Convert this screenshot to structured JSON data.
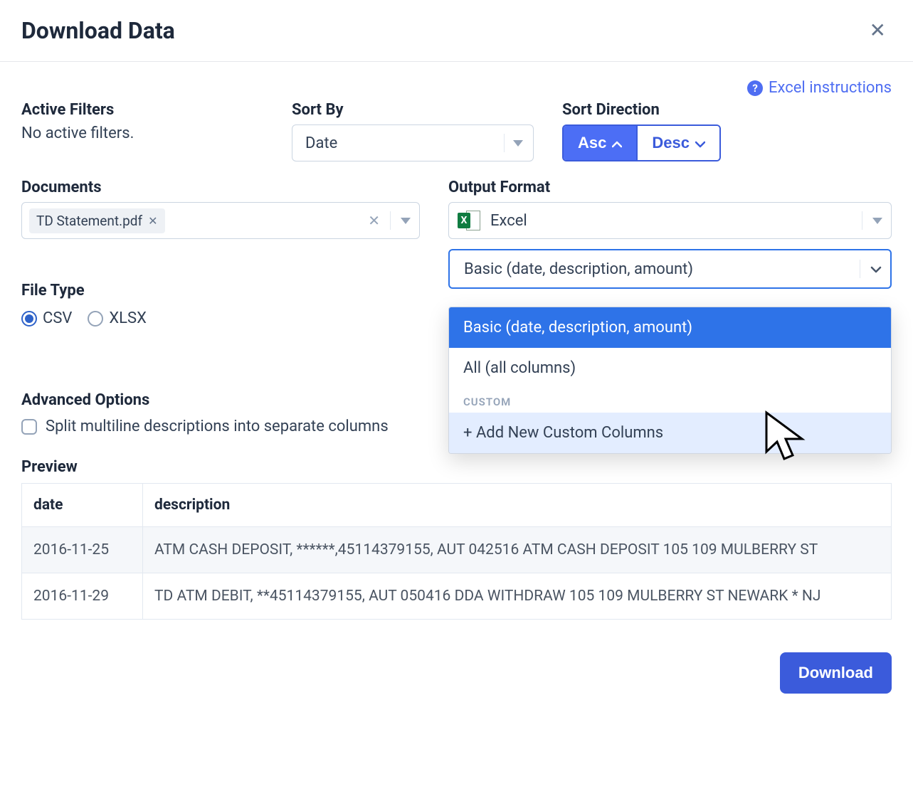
{
  "header": {
    "title": "Download Data"
  },
  "help_link": "Excel instructions",
  "filters": {
    "label": "Active Filters",
    "none_text": "No active filters."
  },
  "sort_by": {
    "label": "Sort By",
    "value": "Date"
  },
  "sort_direction": {
    "label": "Sort Direction",
    "asc": "Asc",
    "desc": "Desc",
    "selected": "Asc"
  },
  "documents": {
    "label": "Documents",
    "tag": "TD Statement.pdf"
  },
  "output_format": {
    "label": "Output Format",
    "value": "Excel",
    "columns_value": "Basic (date, description, amount)",
    "options": {
      "basic": "Basic (date, description, amount)",
      "all": "All (all columns)",
      "custom_label": "CUSTOM",
      "add_custom": "+ Add New Custom Columns"
    }
  },
  "file_type": {
    "label": "File Type",
    "csv": "CSV",
    "xlsx": "XLSX",
    "selected": "CSV"
  },
  "advanced": {
    "label": "Advanced Options",
    "split_desc": "Split multiline descriptions into separate columns"
  },
  "preview": {
    "label": "Preview",
    "headers": {
      "date": "date",
      "description": "description"
    },
    "rows": [
      {
        "date": "2016-11-25",
        "description": "ATM CASH DEPOSIT, ******,45114379155, AUT 042516 ATM CASH DEPOSIT 105 109 MULBERRY ST"
      },
      {
        "date": "2016-11-29",
        "description": "TD ATM DEBIT, **45114379155, AUT 050416 DDA WITHDRAW 105 109 MULBERRY ST NEWARK * NJ"
      }
    ]
  },
  "footer": {
    "download": "Download"
  }
}
